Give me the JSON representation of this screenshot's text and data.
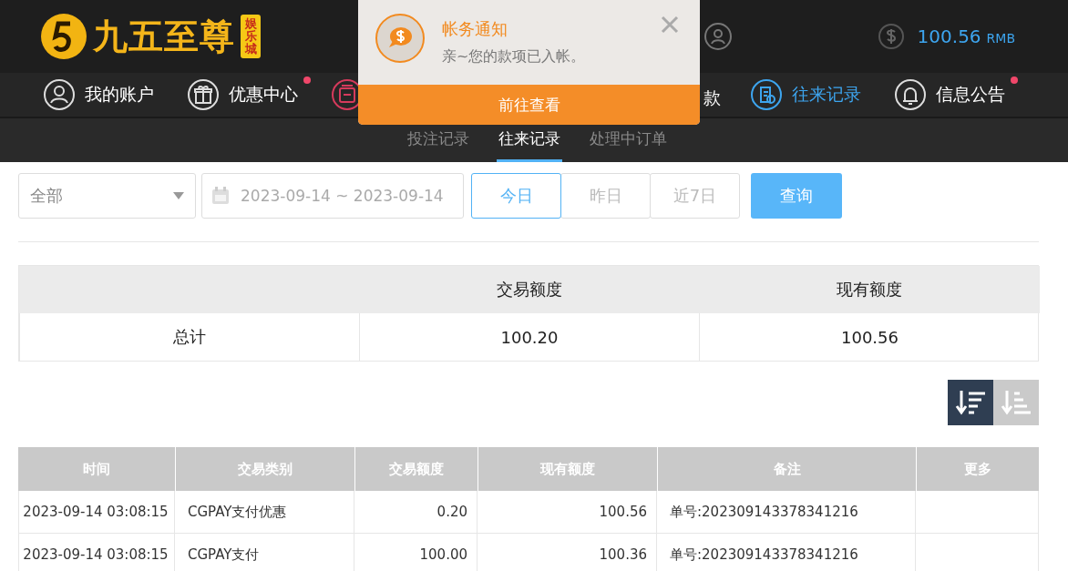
{
  "header": {
    "logo_title": "九五至尊",
    "logo_badge": "娱乐城",
    "balance": "100.56",
    "currency": "RMB"
  },
  "nav": [
    {
      "kind": "full",
      "label": "我的账户",
      "selected": false,
      "badge": false
    },
    {
      "kind": "full",
      "label": "优惠中心",
      "selected": false,
      "badge": true
    },
    {
      "kind": "icon_only",
      "selected": false
    },
    {
      "kind": "text_only",
      "label": "款",
      "selected": false
    },
    {
      "kind": "full",
      "label": "往来记录",
      "selected": true,
      "badge": false
    },
    {
      "kind": "full",
      "label": "信息公告",
      "selected": false,
      "badge": true
    }
  ],
  "subtabs": [
    {
      "label": "投注记录",
      "selected": false
    },
    {
      "label": "往来记录",
      "selected": true
    },
    {
      "label": "处理中订单",
      "selected": false
    }
  ],
  "filters": {
    "type": "全部",
    "date_range": "2023-09-14 ~ 2023-09-14",
    "quick": [
      {
        "label": "今日",
        "selected": true
      },
      {
        "label": "昨日",
        "selected": false
      },
      {
        "label": "近7日",
        "selected": false
      }
    ],
    "search": "查询"
  },
  "summary": {
    "columns": [
      "交易额度",
      "现有额度"
    ],
    "label": "总计",
    "values": [
      "100.20",
      "100.56"
    ]
  },
  "sort": [
    {
      "kind": "desc",
      "selected": true
    },
    {
      "kind": "asc",
      "selected": false
    }
  ],
  "table": {
    "columns": [
      "时间",
      "交易类别",
      "交易额度",
      "现有额度",
      "备注",
      "更多"
    ],
    "rows": [
      [
        "2023-09-14 03:08:15",
        "CGPAY支付优惠",
        "0.20",
        "100.56",
        "单号:202309143378341216",
        ""
      ],
      [
        "2023-09-14 03:08:15",
        "CGPAY支付",
        "100.00",
        "100.36",
        "单号:202309143378341216",
        ""
      ]
    ]
  },
  "notification": {
    "title": "帐务通知",
    "message": "亲~您的款项已入帐。",
    "action": "前往查看"
  }
}
